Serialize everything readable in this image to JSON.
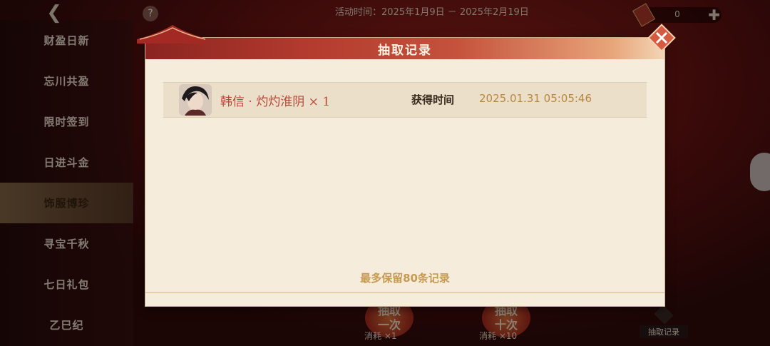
{
  "header": {
    "event_time": "活动时间：2025年1月9日 － 2025年2月19日",
    "currency_count": "0"
  },
  "sidebar": {
    "items": [
      {
        "label": "财盈日新"
      },
      {
        "label": "忘川共盈"
      },
      {
        "label": "限时签到"
      },
      {
        "label": "日进斗金"
      },
      {
        "label": "饰服博珍"
      },
      {
        "label": "寻宝千秋"
      },
      {
        "label": "七日礼包"
      },
      {
        "label": "乙巳纪"
      }
    ],
    "active_index": 4
  },
  "bottom": {
    "draw_once_label": "抽取一次",
    "draw_once_cost": "消耗 ×1",
    "draw_ten_label": "抽取十次",
    "draw_ten_cost": "消耗 ×10",
    "record_label": "抽取记录"
  },
  "modal": {
    "title": "抽取记录",
    "records": [
      {
        "item": "韩信 · 灼灼淮阴 × 1",
        "time_label": "获得时间",
        "time_value": "2025.01.31  05:05:46"
      }
    ],
    "footer": "最多保留80条记录"
  },
  "colors": {
    "accent_red": "#b84a3a",
    "gold": "#c69a53"
  }
}
